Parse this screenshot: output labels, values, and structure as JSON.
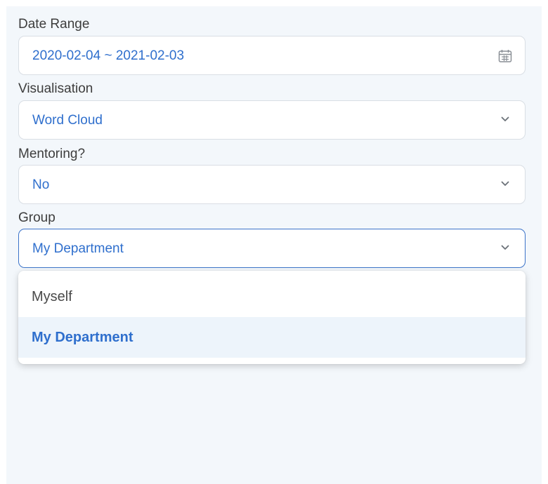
{
  "filters": {
    "date_range": {
      "label": "Date Range",
      "value": "2020-02-04 ~ 2021-02-03",
      "icon": "calendar-icon"
    },
    "visualisation": {
      "label": "Visualisation",
      "value": "Word Cloud",
      "icon": "chevron-down-icon"
    },
    "mentoring": {
      "label": "Mentoring?",
      "value": "No",
      "icon": "chevron-down-icon"
    },
    "group": {
      "label": "Group",
      "value": "My Department",
      "icon": "chevron-down-icon",
      "options": [
        "Myself",
        "My Department"
      ],
      "selected_option": "My Department"
    }
  },
  "colors": {
    "accent": "#2f6fcd",
    "panel_background": "#f3f7fb",
    "selected_option_background": "#edf4fb",
    "focus_border": "#3b73c9"
  }
}
